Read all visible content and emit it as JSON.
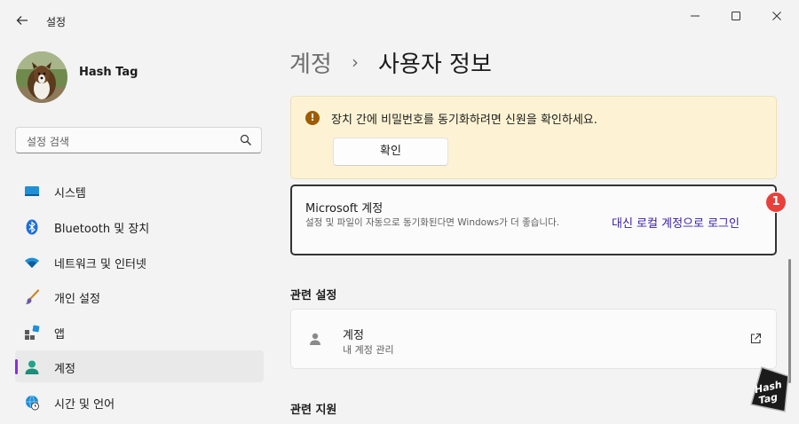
{
  "window": {
    "title": "설정",
    "controls": [
      "minimize-icon",
      "maximize-icon",
      "close-icon"
    ]
  },
  "user": {
    "name": "Hash Tag"
  },
  "search": {
    "placeholder": "설정 검색"
  },
  "sidebar": {
    "items": [
      {
        "label": "시스템",
        "icon": "system-icon",
        "selected": false
      },
      {
        "label": "Bluetooth 및 장치",
        "icon": "bluetooth-icon",
        "selected": false
      },
      {
        "label": "네트워크 및 인터넷",
        "icon": "wifi-icon",
        "selected": false
      },
      {
        "label": "개인 설정",
        "icon": "paintbrush-icon",
        "selected": false
      },
      {
        "label": "앱",
        "icon": "apps-icon",
        "selected": false
      },
      {
        "label": "계정",
        "icon": "account-icon",
        "selected": true
      },
      {
        "label": "시간 및 언어",
        "icon": "globe-clock-icon",
        "selected": false
      }
    ]
  },
  "breadcrumb": {
    "parent": "계정",
    "separator": "›",
    "current": "사용자 정보"
  },
  "banner": {
    "message": "장치 간에 비밀번호를 동기화하려면 신원을 확인하세요.",
    "button": "확인"
  },
  "account_card": {
    "title": "Microsoft 계정",
    "description": "설정 및 파일이 자동으로 동기화된다면 Windows가 더 좋습니다.",
    "link": "대신 로컬 계정으로 로그인",
    "badge": "1"
  },
  "related_settings": {
    "title": "관련 설정",
    "items": [
      {
        "title": "계정",
        "subtitle": "내 계정 관리"
      }
    ]
  },
  "related_support": {
    "title": "관련 지원"
  },
  "watermark": {
    "line1": "Hash",
    "line2": "Tag"
  },
  "colors": {
    "accent": "#8a2fd6",
    "link": "#3b20a8",
    "banner_bg": "#fdf3d4",
    "badge": "#e8413c"
  }
}
